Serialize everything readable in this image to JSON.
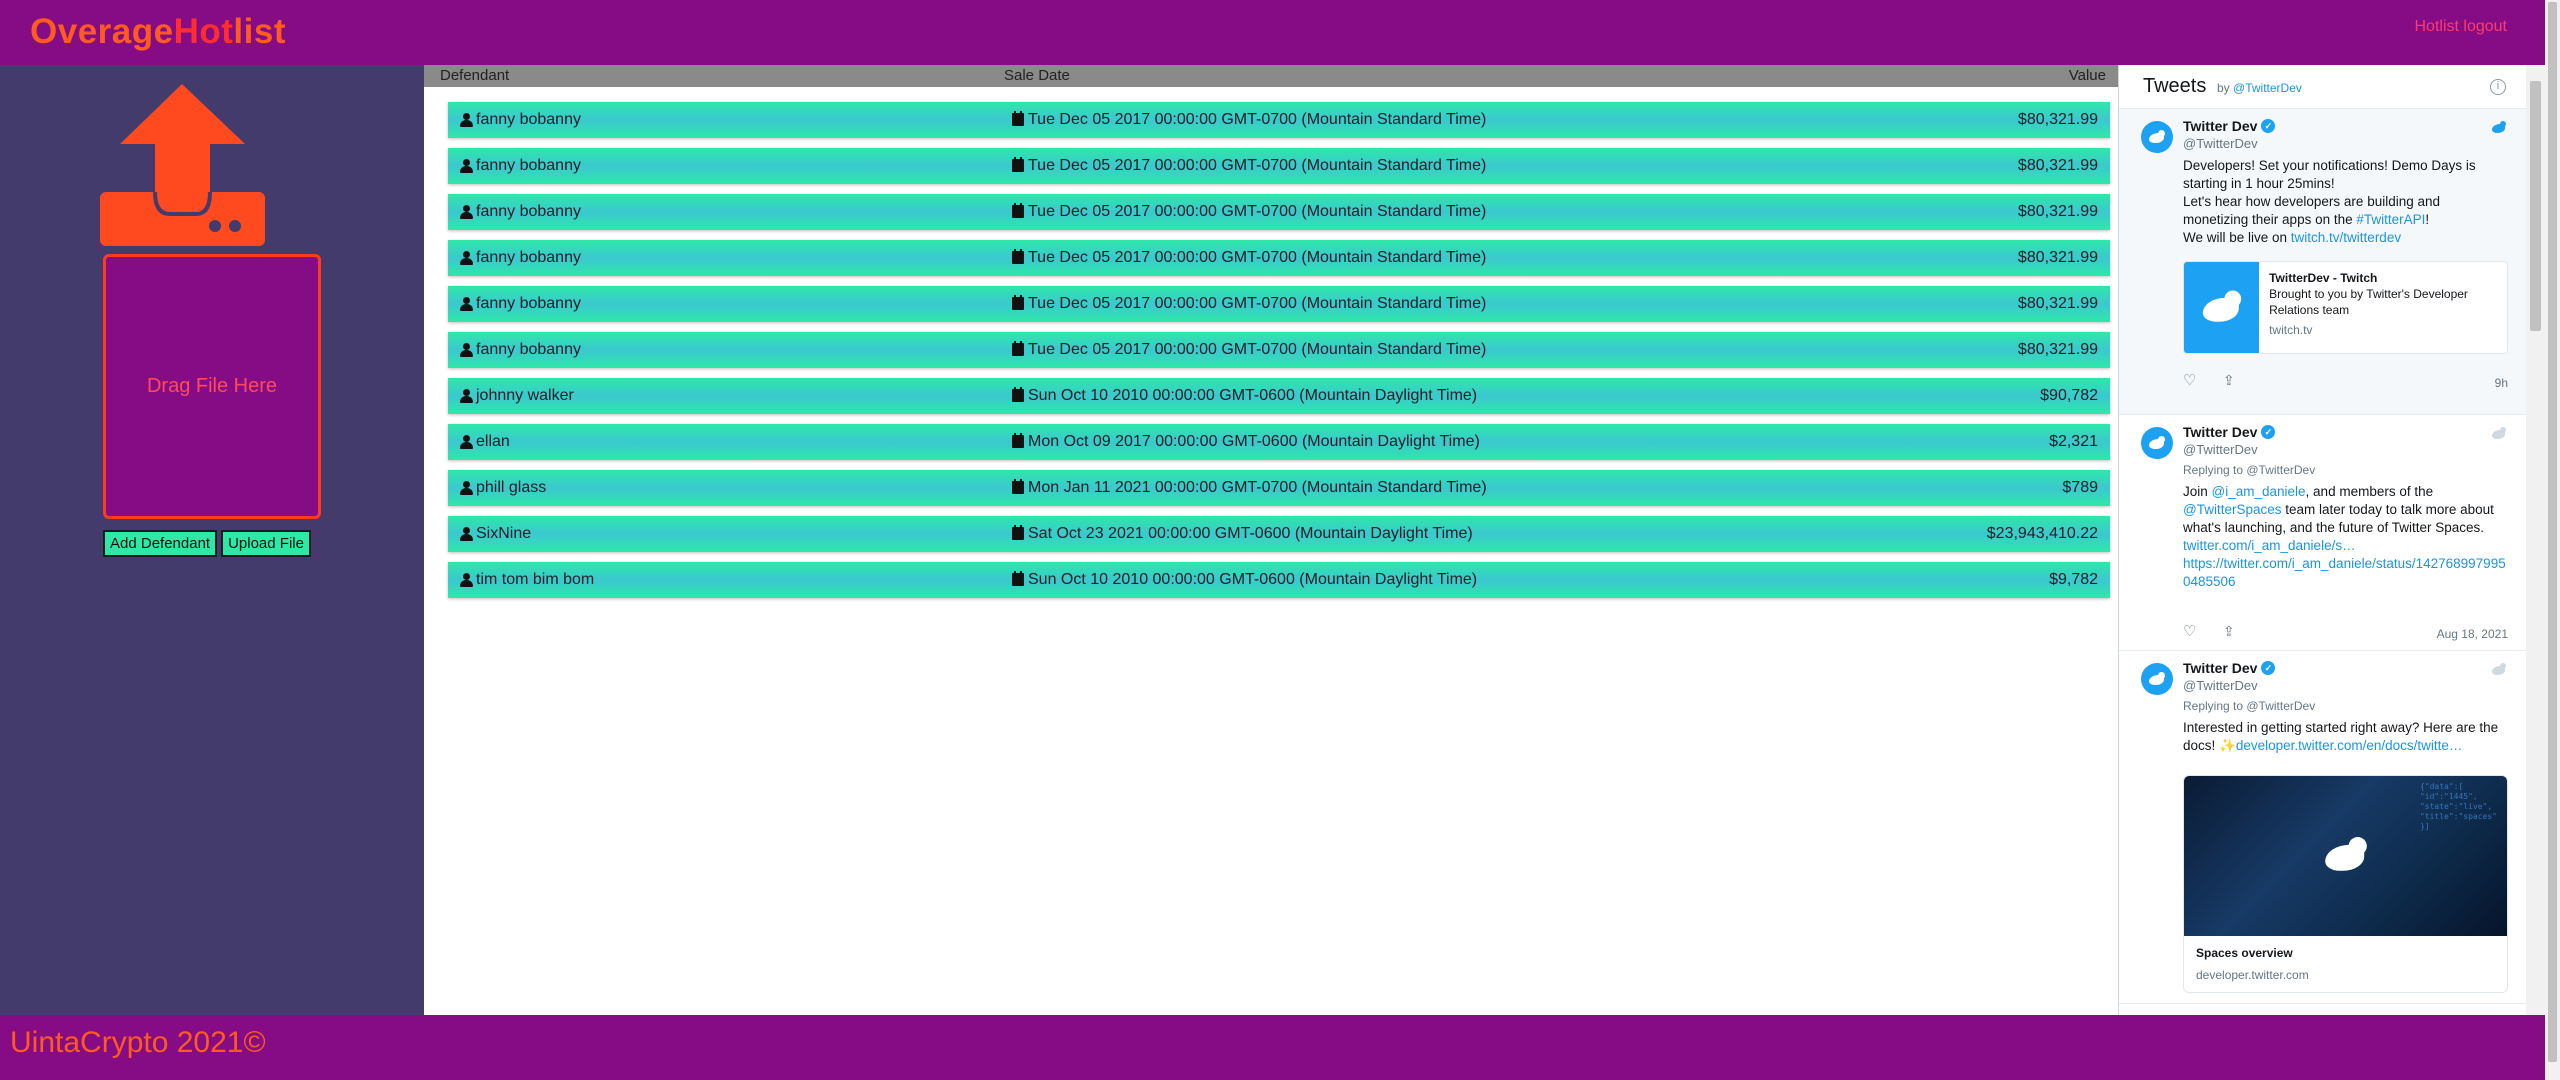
{
  "header": {
    "logo_part1": "Overage",
    "logo_part2": "Hot",
    "logo_part3": "list",
    "logout_label": "Hotlist logout"
  },
  "sidebar": {
    "dropzone_label": "Drag File Here",
    "add_defendant_label": "Add Defendant",
    "upload_file_label": "Upload File"
  },
  "table": {
    "columns": [
      "Defendant",
      "Sale Date",
      "Value"
    ],
    "rows": [
      {
        "defendant": "fanny bobanny",
        "sale_date": "Tue Dec 05 2017 00:00:00 GMT-0700 (Mountain Standard Time)",
        "value": "$80,321.99"
      },
      {
        "defendant": "fanny bobanny",
        "sale_date": "Tue Dec 05 2017 00:00:00 GMT-0700 (Mountain Standard Time)",
        "value": "$80,321.99"
      },
      {
        "defendant": "fanny bobanny",
        "sale_date": "Tue Dec 05 2017 00:00:00 GMT-0700 (Mountain Standard Time)",
        "value": "$80,321.99"
      },
      {
        "defendant": "fanny bobanny",
        "sale_date": "Tue Dec 05 2017 00:00:00 GMT-0700 (Mountain Standard Time)",
        "value": "$80,321.99"
      },
      {
        "defendant": "fanny bobanny",
        "sale_date": "Tue Dec 05 2017 00:00:00 GMT-0700 (Mountain Standard Time)",
        "value": "$80,321.99"
      },
      {
        "defendant": "fanny bobanny",
        "sale_date": "Tue Dec 05 2017 00:00:00 GMT-0700 (Mountain Standard Time)",
        "value": "$80,321.99"
      },
      {
        "defendant": "johnny walker",
        "sale_date": "Sun Oct 10 2010 00:00:00 GMT-0600 (Mountain Daylight Time)",
        "value": "$90,782"
      },
      {
        "defendant": "ellan",
        "sale_date": "Mon Oct 09 2017 00:00:00 GMT-0600 (Mountain Daylight Time)",
        "value": "$2,321"
      },
      {
        "defendant": "phill glass",
        "sale_date": "Mon Jan 11 2021 00:00:00 GMT-0700 (Mountain Standard Time)",
        "value": "$789"
      },
      {
        "defendant": "SixNine",
        "sale_date": "Sat Oct 23 2021 00:00:00 GMT-0600 (Mountain Daylight Time)",
        "value": "$23,943,410.22"
      },
      {
        "defendant": "tim tom bim bom",
        "sale_date": "Sun Oct 10 2010 00:00:00 GMT-0600 (Mountain Daylight Time)",
        "value": "$9,782"
      }
    ]
  },
  "tweets_panel": {
    "title": "Tweets",
    "by_prefix": "by",
    "by_handle": "@TwitterDev",
    "tweets": [
      {
        "name": "Twitter Dev",
        "handle": "@TwitterDev",
        "line1": "Developers! Set your notifications! Demo Days is starting in 1 hour 25mins!",
        "line2_pre": "Let's hear how developers are building and monetizing their apps on the ",
        "line2_link": "#TwitterAPI",
        "line2_post": "!",
        "line3_pre": "We will be live on ",
        "line3_link": "twitch.tv/twitterdev",
        "card_title": "TwitterDev - Twitch",
        "card_desc": "Brought to you by Twitter's Developer Relations team",
        "card_domain": "twitch.tv",
        "time": "9h"
      },
      {
        "name": "Twitter Dev",
        "handle": "@TwitterDev",
        "reply": "Replying to @TwitterDev",
        "text_pre": "Join ",
        "mention1": "@i_am_daniele",
        "text_mid": ", and members of the ",
        "mention2": "@TwitterSpaces",
        "text_post": " team later today to talk more about what's launching, and the future of Twitter Spaces. ",
        "link1": "twitter.com/i_am_daniele/s…",
        "link2": "https://twitter.com/i_am_daniele/status/1427689979950485506",
        "time": "Aug 18, 2021"
      },
      {
        "name": "Twitter Dev",
        "handle": "@TwitterDev",
        "reply": "Replying to @TwitterDev",
        "text_pre": "Interested in getting started right away? Here are the docs! ✨",
        "link": "developer.twitter.com/en/docs/twitte…",
        "card_title": "Spaces overview",
        "card_domain": "developer.twitter.com"
      }
    ]
  },
  "footer": {
    "copyright": "UintaCrypto 2021©"
  },
  "colors": {
    "header_bg": "#850c85",
    "sidebar_bg": "#433b6b",
    "accent_orange": "#ff5a1f",
    "row_green": "#2ee8a8",
    "row_teal": "#3bc8d0",
    "twitter_blue": "#1da1f2"
  }
}
